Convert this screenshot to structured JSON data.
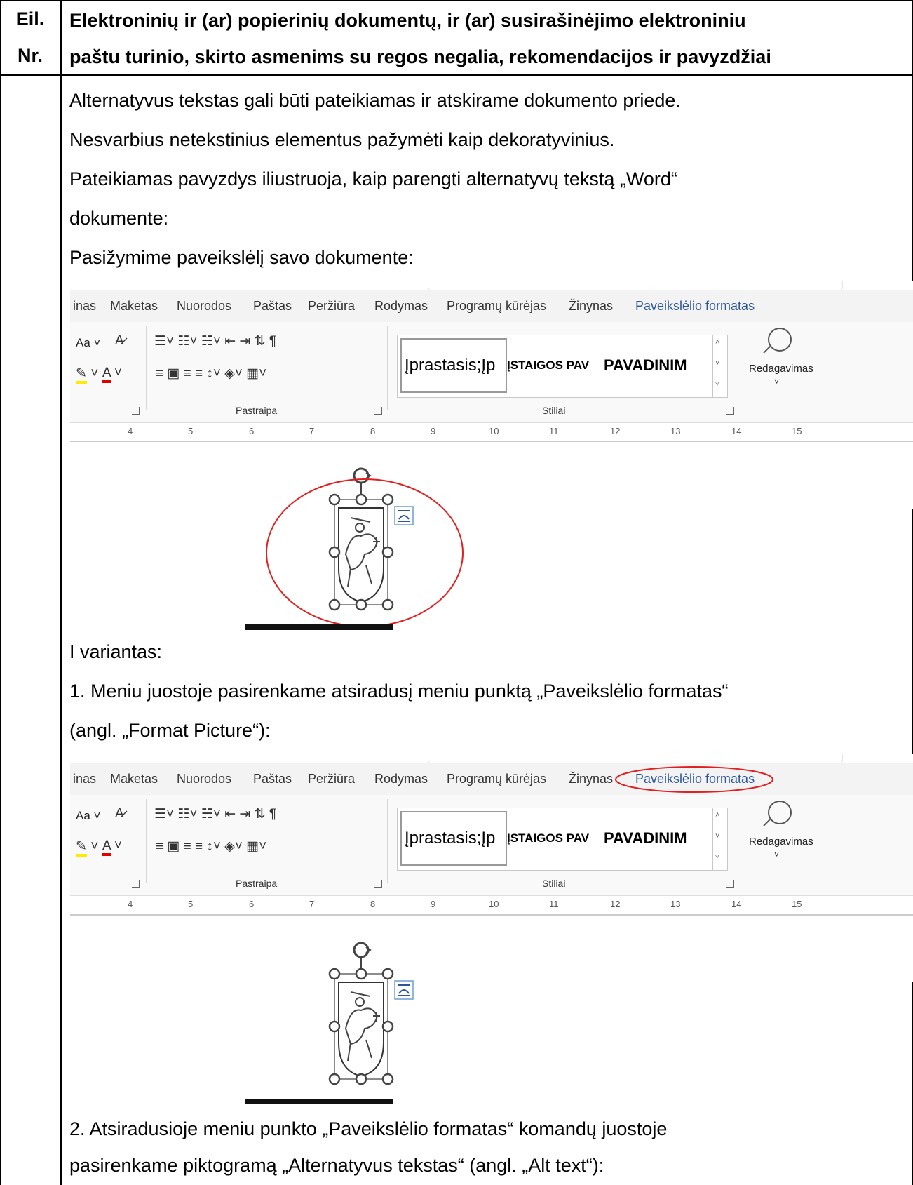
{
  "header": {
    "num_line1": "Eil.",
    "num_line2": "Nr.",
    "title_line1": "Elektroninių ir (ar) popierinių dokumentų, ir (ar) susirašinėjimo elektroniniu",
    "title_line2": "paštu turinio, skirto asmenims su regos negalia, rekomendacijos ir pavyzdžiai"
  },
  "body": {
    "p1": "Alternatyvus tekstas gali būti pateikiamas ir atskirame dokumento priede.",
    "p2": "Nesvarbius netekstinius elementus pažymėti kaip dekoratyvinius.",
    "p3a": "Pateikiamas pavyzdys iliustruoja, kaip parengti alternatyvų tekstą „Word“",
    "p3b": "dokumente:",
    "p4": "Pasižymime paveikslėlį savo dokumente:",
    "p5": "I variantas:",
    "p6a": "1. Meniu juostoje pasirenkame atsiradusį meniu punktą „Paveikslėlio formatas“",
    "p6b": "(angl. „Format Picture“):",
    "p7a": "2. Atsiradusioje meniu punkto „Paveikslėlio formatas“ komandų juostoje",
    "p7b": "pasirenkame piktogramą „Alternatyvus tekstas“ (angl. „Alt text“):"
  },
  "ribbon": {
    "tabs": [
      "inas",
      "Maketas",
      "Nuorodos",
      "Paštas",
      "Peržiūra",
      "Rodymas",
      "Programų kūrėjas",
      "Žinynas",
      "Paveikslėlio formatas"
    ],
    "font_case": "Aa",
    "paragraph_group": "Pastraipa",
    "styles_group": "Stiliai",
    "style_items": [
      "Įprastasis;Įp",
      "ĮSTAIGOS PAV",
      "PAVADINIM"
    ],
    "editing": "Redagavimas",
    "ruler_numbers": [
      "4",
      "5",
      "6",
      "7",
      "8",
      "9",
      "10",
      "11",
      "12",
      "13",
      "14",
      "15"
    ]
  },
  "colors": {
    "active_tab": "#2b579a",
    "highlight_circle": "#e02020"
  }
}
